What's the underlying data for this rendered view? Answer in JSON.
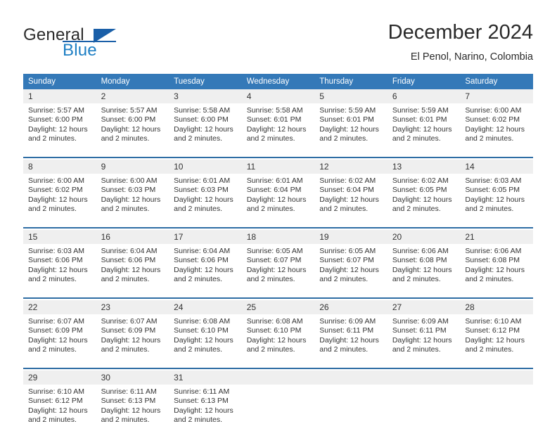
{
  "brand": {
    "name_part1": "General",
    "name_part2": "Blue",
    "flag_icon": "triangle-flag-icon"
  },
  "header": {
    "title": "December 2024",
    "subtitle": "El Penol, Narino, Colombia"
  },
  "colors": {
    "header_blue": "#3479b8",
    "separator_blue": "#2e6da4",
    "daynum_band": "#efefef",
    "brand_blue": "#1e7fc4",
    "text": "#333333"
  },
  "weekday_headers": [
    "Sunday",
    "Monday",
    "Tuesday",
    "Wednesday",
    "Thursday",
    "Friday",
    "Saturday"
  ],
  "labels": {
    "sunrise_prefix": "Sunrise:",
    "sunset_prefix": "Sunset:",
    "daylight_prefix": "Daylight:"
  },
  "weeks": [
    {
      "days": [
        {
          "num": "1",
          "sunrise": "Sunrise: 5:57 AM",
          "sunset": "Sunset: 6:00 PM",
          "daylight1": "Daylight: 12 hours",
          "daylight2": "and 2 minutes."
        },
        {
          "num": "2",
          "sunrise": "Sunrise: 5:57 AM",
          "sunset": "Sunset: 6:00 PM",
          "daylight1": "Daylight: 12 hours",
          "daylight2": "and 2 minutes."
        },
        {
          "num": "3",
          "sunrise": "Sunrise: 5:58 AM",
          "sunset": "Sunset: 6:00 PM",
          "daylight1": "Daylight: 12 hours",
          "daylight2": "and 2 minutes."
        },
        {
          "num": "4",
          "sunrise": "Sunrise: 5:58 AM",
          "sunset": "Sunset: 6:01 PM",
          "daylight1": "Daylight: 12 hours",
          "daylight2": "and 2 minutes."
        },
        {
          "num": "5",
          "sunrise": "Sunrise: 5:59 AM",
          "sunset": "Sunset: 6:01 PM",
          "daylight1": "Daylight: 12 hours",
          "daylight2": "and 2 minutes."
        },
        {
          "num": "6",
          "sunrise": "Sunrise: 5:59 AM",
          "sunset": "Sunset: 6:01 PM",
          "daylight1": "Daylight: 12 hours",
          "daylight2": "and 2 minutes."
        },
        {
          "num": "7",
          "sunrise": "Sunrise: 6:00 AM",
          "sunset": "Sunset: 6:02 PM",
          "daylight1": "Daylight: 12 hours",
          "daylight2": "and 2 minutes."
        }
      ]
    },
    {
      "days": [
        {
          "num": "8",
          "sunrise": "Sunrise: 6:00 AM",
          "sunset": "Sunset: 6:02 PM",
          "daylight1": "Daylight: 12 hours",
          "daylight2": "and 2 minutes."
        },
        {
          "num": "9",
          "sunrise": "Sunrise: 6:00 AM",
          "sunset": "Sunset: 6:03 PM",
          "daylight1": "Daylight: 12 hours",
          "daylight2": "and 2 minutes."
        },
        {
          "num": "10",
          "sunrise": "Sunrise: 6:01 AM",
          "sunset": "Sunset: 6:03 PM",
          "daylight1": "Daylight: 12 hours",
          "daylight2": "and 2 minutes."
        },
        {
          "num": "11",
          "sunrise": "Sunrise: 6:01 AM",
          "sunset": "Sunset: 6:04 PM",
          "daylight1": "Daylight: 12 hours",
          "daylight2": "and 2 minutes."
        },
        {
          "num": "12",
          "sunrise": "Sunrise: 6:02 AM",
          "sunset": "Sunset: 6:04 PM",
          "daylight1": "Daylight: 12 hours",
          "daylight2": "and 2 minutes."
        },
        {
          "num": "13",
          "sunrise": "Sunrise: 6:02 AM",
          "sunset": "Sunset: 6:05 PM",
          "daylight1": "Daylight: 12 hours",
          "daylight2": "and 2 minutes."
        },
        {
          "num": "14",
          "sunrise": "Sunrise: 6:03 AM",
          "sunset": "Sunset: 6:05 PM",
          "daylight1": "Daylight: 12 hours",
          "daylight2": "and 2 minutes."
        }
      ]
    },
    {
      "days": [
        {
          "num": "15",
          "sunrise": "Sunrise: 6:03 AM",
          "sunset": "Sunset: 6:06 PM",
          "daylight1": "Daylight: 12 hours",
          "daylight2": "and 2 minutes."
        },
        {
          "num": "16",
          "sunrise": "Sunrise: 6:04 AM",
          "sunset": "Sunset: 6:06 PM",
          "daylight1": "Daylight: 12 hours",
          "daylight2": "and 2 minutes."
        },
        {
          "num": "17",
          "sunrise": "Sunrise: 6:04 AM",
          "sunset": "Sunset: 6:06 PM",
          "daylight1": "Daylight: 12 hours",
          "daylight2": "and 2 minutes."
        },
        {
          "num": "18",
          "sunrise": "Sunrise: 6:05 AM",
          "sunset": "Sunset: 6:07 PM",
          "daylight1": "Daylight: 12 hours",
          "daylight2": "and 2 minutes."
        },
        {
          "num": "19",
          "sunrise": "Sunrise: 6:05 AM",
          "sunset": "Sunset: 6:07 PM",
          "daylight1": "Daylight: 12 hours",
          "daylight2": "and 2 minutes."
        },
        {
          "num": "20",
          "sunrise": "Sunrise: 6:06 AM",
          "sunset": "Sunset: 6:08 PM",
          "daylight1": "Daylight: 12 hours",
          "daylight2": "and 2 minutes."
        },
        {
          "num": "21",
          "sunrise": "Sunrise: 6:06 AM",
          "sunset": "Sunset: 6:08 PM",
          "daylight1": "Daylight: 12 hours",
          "daylight2": "and 2 minutes."
        }
      ]
    },
    {
      "days": [
        {
          "num": "22",
          "sunrise": "Sunrise: 6:07 AM",
          "sunset": "Sunset: 6:09 PM",
          "daylight1": "Daylight: 12 hours",
          "daylight2": "and 2 minutes."
        },
        {
          "num": "23",
          "sunrise": "Sunrise: 6:07 AM",
          "sunset": "Sunset: 6:09 PM",
          "daylight1": "Daylight: 12 hours",
          "daylight2": "and 2 minutes."
        },
        {
          "num": "24",
          "sunrise": "Sunrise: 6:08 AM",
          "sunset": "Sunset: 6:10 PM",
          "daylight1": "Daylight: 12 hours",
          "daylight2": "and 2 minutes."
        },
        {
          "num": "25",
          "sunrise": "Sunrise: 6:08 AM",
          "sunset": "Sunset: 6:10 PM",
          "daylight1": "Daylight: 12 hours",
          "daylight2": "and 2 minutes."
        },
        {
          "num": "26",
          "sunrise": "Sunrise: 6:09 AM",
          "sunset": "Sunset: 6:11 PM",
          "daylight1": "Daylight: 12 hours",
          "daylight2": "and 2 minutes."
        },
        {
          "num": "27",
          "sunrise": "Sunrise: 6:09 AM",
          "sunset": "Sunset: 6:11 PM",
          "daylight1": "Daylight: 12 hours",
          "daylight2": "and 2 minutes."
        },
        {
          "num": "28",
          "sunrise": "Sunrise: 6:10 AM",
          "sunset": "Sunset: 6:12 PM",
          "daylight1": "Daylight: 12 hours",
          "daylight2": "and 2 minutes."
        }
      ]
    },
    {
      "days": [
        {
          "num": "29",
          "sunrise": "Sunrise: 6:10 AM",
          "sunset": "Sunset: 6:12 PM",
          "daylight1": "Daylight: 12 hours",
          "daylight2": "and 2 minutes."
        },
        {
          "num": "30",
          "sunrise": "Sunrise: 6:11 AM",
          "sunset": "Sunset: 6:13 PM",
          "daylight1": "Daylight: 12 hours",
          "daylight2": "and 2 minutes."
        },
        {
          "num": "31",
          "sunrise": "Sunrise: 6:11 AM",
          "sunset": "Sunset: 6:13 PM",
          "daylight1": "Daylight: 12 hours",
          "daylight2": "and 2 minutes."
        },
        {
          "num": "",
          "sunrise": "",
          "sunset": "",
          "daylight1": "",
          "daylight2": ""
        },
        {
          "num": "",
          "sunrise": "",
          "sunset": "",
          "daylight1": "",
          "daylight2": ""
        },
        {
          "num": "",
          "sunrise": "",
          "sunset": "",
          "daylight1": "",
          "daylight2": ""
        },
        {
          "num": "",
          "sunrise": "",
          "sunset": "",
          "daylight1": "",
          "daylight2": ""
        }
      ]
    }
  ]
}
